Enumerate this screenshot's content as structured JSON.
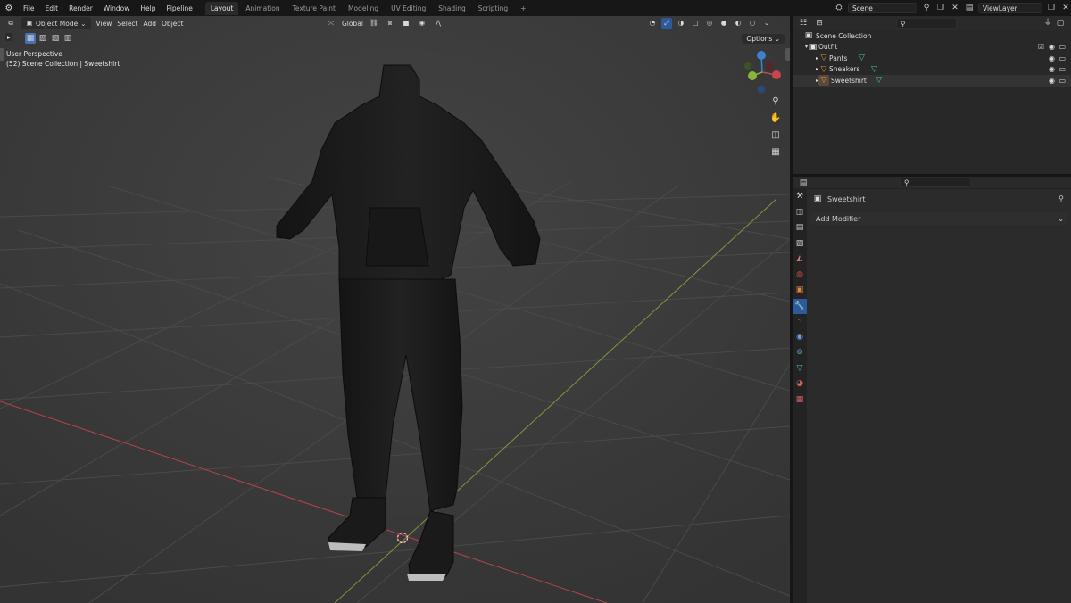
{
  "app": {
    "logo_icon": "blender-logo-icon"
  },
  "menu": [
    "File",
    "Edit",
    "Render",
    "Window",
    "Help",
    "Pipeline"
  ],
  "workspaces": [
    {
      "label": "Layout",
      "active": true
    },
    {
      "label": "Animation",
      "active": false
    },
    {
      "label": "Texture Paint",
      "active": false
    },
    {
      "label": "Modeling",
      "active": false
    },
    {
      "label": "UV Editing",
      "active": false
    },
    {
      "label": "Shading",
      "active": false
    },
    {
      "label": "Scripting",
      "active": false
    },
    {
      "label": "+",
      "active": false
    }
  ],
  "scene": {
    "name": "Scene",
    "view_layer": "ViewLayer"
  },
  "viewport": {
    "mode": "Object Mode",
    "menus": [
      "View",
      "Select",
      "Add",
      "Object"
    ],
    "transform_orientation": "Global",
    "options_label": "Options",
    "perspective_label": "User Perspective",
    "collection_label": "(52) Scene Collection | Sweetshirt"
  },
  "outliner": {
    "root": "Scene Collection",
    "collection": "Outfit",
    "objects": [
      {
        "name": "Pants"
      },
      {
        "name": "Sneakers"
      },
      {
        "name": "Sweetshirt"
      }
    ]
  },
  "properties": {
    "object_name": "Sweetshirt",
    "add_modifier_label": "Add Modifier"
  },
  "colors": {
    "x_axis": "#c7454e",
    "y_axis": "#8ab53a",
    "z_axis": "#3b82cf",
    "accent": "#4772b3",
    "active_tab": "#2d5a9a"
  }
}
